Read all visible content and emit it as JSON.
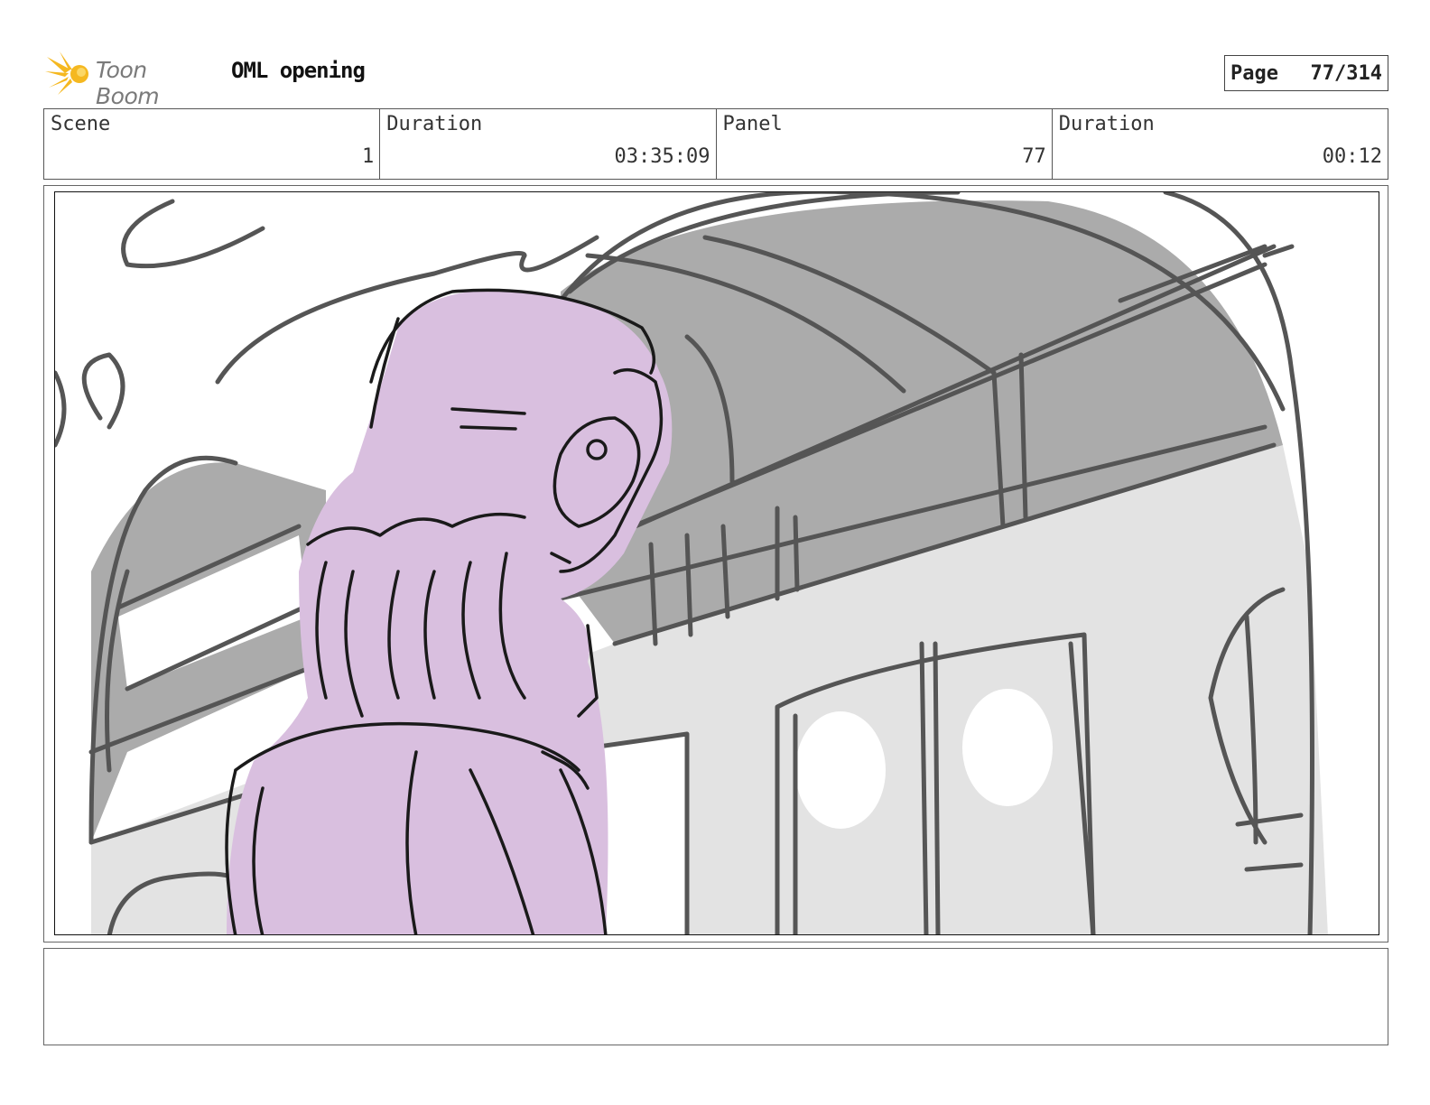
{
  "header": {
    "logo_text": "Toon Boom",
    "project_title": "OML opening",
    "page_label": "Page",
    "page_value": "77/314"
  },
  "info": {
    "scene_label": "Scene",
    "scene_value": "1",
    "duration_label": "Duration",
    "duration_value": "03:35:09",
    "panel_label": "Panel",
    "panel_value": "77",
    "panel_duration_label": "Duration",
    "panel_duration_value": "00:12"
  },
  "colors": {
    "logo_orange": "#f5b820",
    "character_fill": "#d9bfdf",
    "ceiling_gray": "#ababab",
    "wall_light_gray": "#e3e3e3",
    "sketch_line": "#555555"
  },
  "notes": {
    "text": ""
  }
}
